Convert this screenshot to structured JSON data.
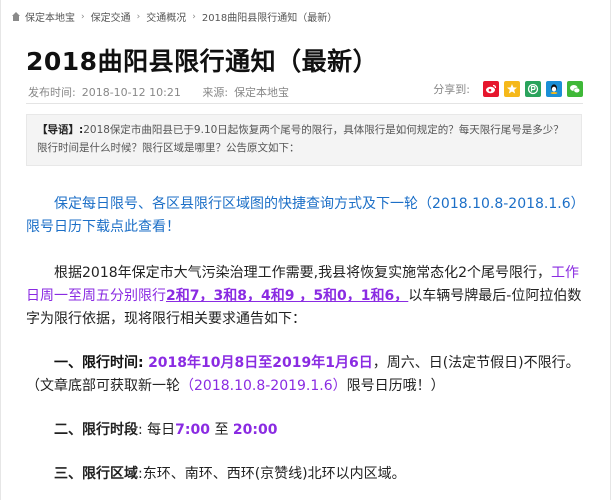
{
  "breadcrumb": {
    "items": [
      "保定本地宝",
      "保定交通",
      "交通概况",
      "2018曲阳县限行通知（最新）"
    ],
    "separator": "›"
  },
  "article": {
    "title": "2018曲阳县限行通知（最新）",
    "publish_label": "发布时间:",
    "publish_time": "2018-10-12 10:21",
    "source_label": "来源:",
    "source": "保定本地宝",
    "share_label": "分享到:",
    "share_icons": [
      "weibo-icon",
      "qzone-icon",
      "pengyou-icon",
      "qq-icon",
      "wechat-icon"
    ]
  },
  "lead": {
    "tag": "【导语】:",
    "text": "2018保定市曲阳县已于9.10日起恢复两个尾号的限行，具体限行是如何规定的？每天限行尾号是多少？限行时间是什么时候？限行区域是哪里？公告原文如下："
  },
  "body": {
    "p1": "保定每日限号、各区县限行区域图的快捷查询方式及下一轮（2018.10.8-2018.1.6）限号日历下载点此查看！",
    "p2_a": "根据2018年保定市大气污染治理工作需要,我县将恢复实施常态化2个尾号限行，",
    "p2_b": "工作日周一至周五分别限行",
    "p2_c": "2和7，3和8，4和9 ，5和0，1和6，",
    "p2_d": "以车辆号牌最后-位阿拉伯数字为限行依据，现将限行相关要求通告如下：",
    "p3_label": "一、限行时间:",
    "p3_date": "2018年10月8日至2019年1月6日",
    "p3_mid": "，周六、日(法定节假日)不限行。（文章底部可获取新一轮",
    "p3_range": "（2018.10.8-2019.1.6）",
    "p3_end": "限号日历哦！）",
    "p4_label": "二、限行时段",
    "p4_pre": ": 每日",
    "p4_start": "7:00",
    "p4_to": " 至 ",
    "p4_end": "20:00",
    "p5_label": "三、限行区域",
    "p5_text": ":东环、南环、西环(京赞线)北环以内区域。"
  },
  "colors": {
    "accent_blue": "#1c6fc7",
    "accent_purple": "#8a2be2"
  }
}
